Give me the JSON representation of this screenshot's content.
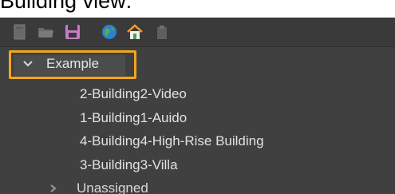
{
  "caption": "Building view:",
  "toolbar": {
    "buttons": [
      {
        "icon": "document-icon"
      },
      {
        "icon": "folder-open-icon"
      },
      {
        "icon": "save-icon"
      },
      {
        "icon": "globe-icon"
      },
      {
        "icon": "home-icon"
      },
      {
        "icon": "clipboard-icon"
      }
    ]
  },
  "tree": {
    "root": {
      "label": "Example",
      "expanded": true,
      "selected": true
    },
    "children": [
      "2-Building2-Video",
      "1-Building1-Auido",
      "4-Building4-High-Rise Building",
      "3-Building3-Villa"
    ],
    "unassigned": {
      "label": "Unassigned",
      "expanded": false
    }
  },
  "colors": {
    "panel_bg": "#404040",
    "highlight_border": "#f0a81c",
    "text": "#e2e2e2"
  }
}
